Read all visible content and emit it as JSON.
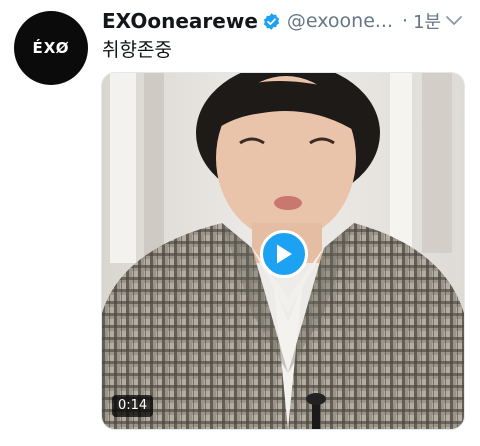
{
  "tweet": {
    "author": {
      "display_name": "EXOonearewe",
      "handle": "@exoone...",
      "verified": true,
      "verified_icon": "verified-badge-icon",
      "avatar_text": "ÉXØ"
    },
    "separator": "·",
    "timestamp": "1분",
    "text": "취향존중",
    "menu_icon": "chevron-down-icon",
    "media": {
      "type": "video",
      "duration": "0:14",
      "play_icon": "play-icon"
    }
  },
  "colors": {
    "accent": "#1da1f2",
    "text": "#14171a",
    "secondary_text": "#657786",
    "avatar_bg": "#0b0b0b"
  }
}
